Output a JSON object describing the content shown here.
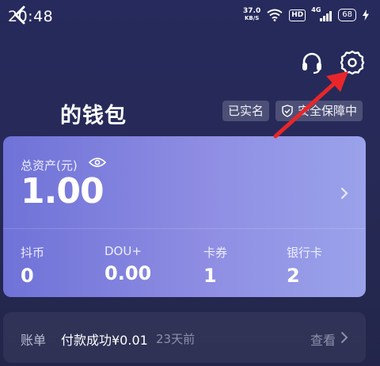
{
  "status_bar": {
    "time": "20:48",
    "net_speed_value": "37.0",
    "net_speed_unit": "KB/S",
    "hd_label": "HD",
    "network_label": "4G",
    "battery": "68"
  },
  "nav": {
    "back_icon": "chevron-left-icon",
    "support_icon": "headset-icon",
    "settings_icon": "gear-icon"
  },
  "header": {
    "title": "的钱包",
    "badge_verified": "已实名",
    "badge_secure": "安全保障中"
  },
  "wallet_card": {
    "assets_label": "总资产(元)",
    "balance": "1.00",
    "stats": [
      {
        "label": "抖币",
        "value": "0"
      },
      {
        "label": "DOU+",
        "value": "0.00"
      },
      {
        "label": "卡券",
        "value": "1"
      },
      {
        "label": "银行卡",
        "value": "2"
      }
    ]
  },
  "bill": {
    "title": "账单",
    "description": "付款成功¥0.01",
    "time_ago": "23天前",
    "view_label": "查看"
  },
  "colors": {
    "annotation_arrow": "#e8262a",
    "card_gradient_start": "#6f72d7",
    "card_gradient_end": "#9aa2ea",
    "background": "#262a5c"
  }
}
